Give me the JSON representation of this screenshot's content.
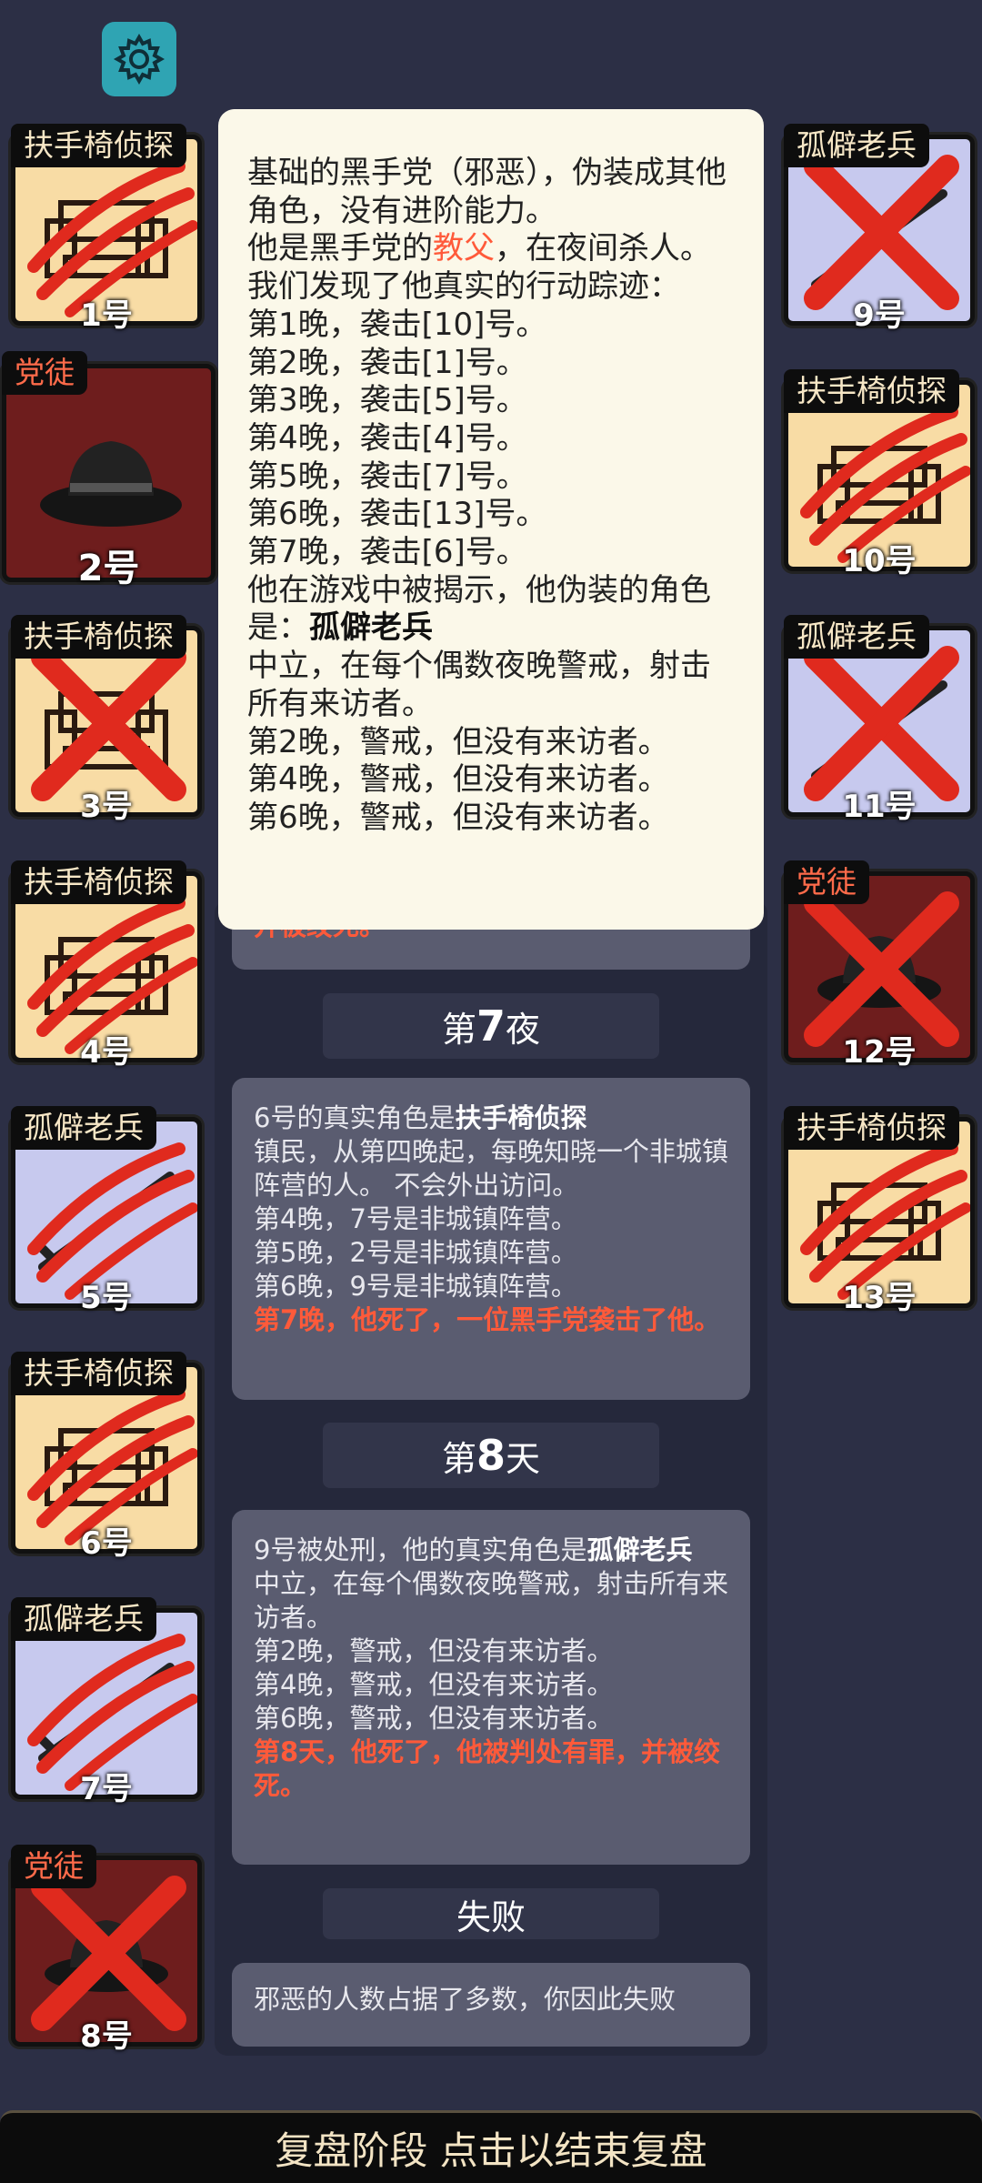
{
  "players": [
    {
      "num": "1号",
      "role": "扶手椅侦探"
    },
    {
      "num": "2号",
      "role": "党徒"
    },
    {
      "num": "3号",
      "role": "扶手椅侦探"
    },
    {
      "num": "4号",
      "role": "扶手椅侦探"
    },
    {
      "num": "5号",
      "role": "孤僻老兵"
    },
    {
      "num": "6号",
      "role": "扶手椅侦探"
    },
    {
      "num": "7号",
      "role": "孤僻老兵"
    },
    {
      "num": "8号",
      "role": "党徒"
    },
    {
      "num": "9号",
      "role": "孤僻老兵"
    },
    {
      "num": "10号",
      "role": "扶手椅侦探"
    },
    {
      "num": "11号",
      "role": "孤僻老兵"
    },
    {
      "num": "12号",
      "role": "党徒"
    },
    {
      "num": "13号",
      "role": "扶手椅侦探"
    }
  ],
  "popup": {
    "l1": "基础的黑手党（邪恶），伪装成其他角色，没有进阶能力。",
    "l2a": "他是黑手党的",
    "l2b": "教父",
    "l2c": "，在夜间杀人。",
    "l3": "我们发现了他真实的行动踪迹：",
    "n1": "第1晚，袭击[10]号。",
    "n2": "第2晚，袭击[1]号。",
    "n3": "第3晚，袭击[5]号。",
    "n4": "第4晚，袭击[4]号。",
    "n5": "第5晚，袭击[7]号。",
    "n6": "第6晚，袭击[13]号。",
    "n7": "第7晚，袭击[6]号。",
    "l4a": "他在游戏中被揭示，他伪装的角色是：",
    "l4b": "孤僻老兵",
    "l5": "中立，在每个偶数夜晚警戒，射击所有来访者。",
    "w2": "第2晚，警戒，但没有来访者。",
    "w4": "第4晚，警戒，但没有来访者。",
    "w6": "第6晚，警戒，但没有来访者。"
  },
  "hidden_tail": "并被绞死。",
  "night7": {
    "prefix": "第",
    "num": "7",
    "suffix": "夜"
  },
  "night7_card": {
    "h1": "6号的真实角色是",
    "h2": "扶手椅侦探",
    "d1": "镇民，从第四晚起，每晚知晓一个非城镇阵营的人。 不会外出访问。",
    "d2": "第4晚，7号是非城镇阵营。",
    "d3": "第5晚，2号是非城镇阵营。",
    "d4": "第6晚，9号是非城镇阵营。",
    "death": "第7晚，他死了，一位黑手党袭击了他。"
  },
  "day8": {
    "prefix": "第",
    "num": "8",
    "suffix": "天"
  },
  "day8_card": {
    "h1": "9号被处刑，他的真实角色是",
    "h2": "孤僻老兵",
    "d1": "中立，在每个偶数夜晚警戒，射击所有来访者。",
    "d2": "第2晚，警戒，但没有来访者。",
    "d3": "第4晚，警戒，但没有来访者。",
    "d4": "第6晚，警戒，但没有来访者。",
    "death": "第8天，他死了，他被判处有罪，并被绞死。"
  },
  "result_label": "失败",
  "result_text": "邪恶的人数占据了多数，你因此失败",
  "bottom_bar": "复盘阶段 点击以结束复盘",
  "colors": {
    "bg": "#2c2f45",
    "accent_red": "#ff5a3a",
    "popup_bg": "#fbf8e9"
  }
}
